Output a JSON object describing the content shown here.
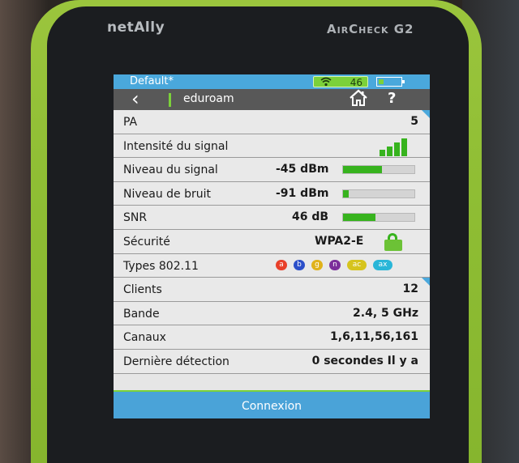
{
  "device": {
    "brand": "netAlly",
    "model": "AirCheck G2"
  },
  "status_bar": {
    "profile": "Default*",
    "wifi_count": "46",
    "battery_level": 0.2
  },
  "title_bar": {
    "ssid": "eduroam",
    "back_icon": "chevron-left-icon",
    "home_icon": "home-icon",
    "help_label": "?"
  },
  "rows": {
    "pa": {
      "label": "PA",
      "value": "5"
    },
    "signal_intensity": {
      "label": "Intensité du signal",
      "bars": 4
    },
    "signal_level": {
      "label": "Niveau du signal",
      "value": "-45 dBm",
      "level": 0.55
    },
    "noise_level": {
      "label": "Niveau de bruit",
      "value": "-91 dBm",
      "level": 0.08
    },
    "snr": {
      "label": "SNR",
      "value": "46 dB",
      "level": 0.45
    },
    "security": {
      "label": "Sécurité",
      "value": "WPA2-E"
    },
    "types_80211": {
      "label": "Types 802.11",
      "chips": [
        {
          "text": "a",
          "color": "#e8402a"
        },
        {
          "text": "b",
          "color": "#2b4fc9"
        },
        {
          "text": "g",
          "color": "#e0b21a"
        },
        {
          "text": "n",
          "color": "#7b2e9a"
        },
        {
          "text": "ac",
          "color": "#d6c41e"
        },
        {
          "text": "ax",
          "color": "#29b6d8"
        }
      ]
    },
    "clients": {
      "label": "Clients",
      "value": "12"
    },
    "band": {
      "label": "Bande",
      "value": "2.4, 5 GHz"
    },
    "channels": {
      "label": "Canaux",
      "value": "1,6,11,56,161"
    },
    "last_seen": {
      "label": "Dernière détection",
      "value": "0  secondes Il y a"
    }
  },
  "connect_button": {
    "label": "Connexion"
  },
  "colors": {
    "accent_blue": "#4aa8dc",
    "accent_green": "#7bd13a",
    "meter_green": "#37b31e"
  }
}
